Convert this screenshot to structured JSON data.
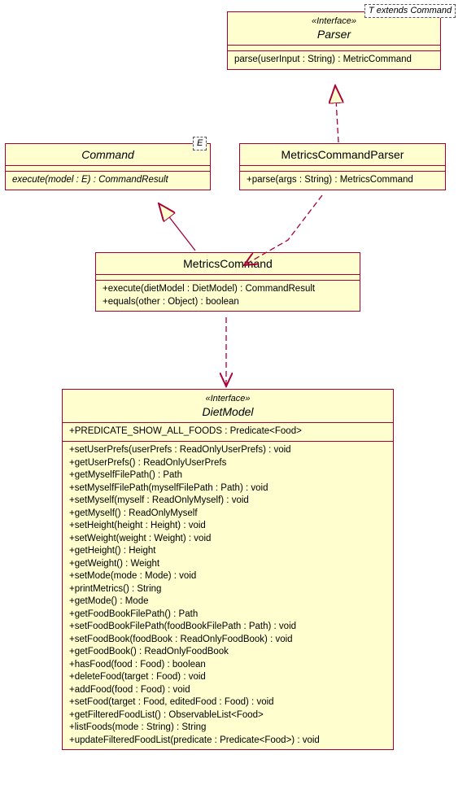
{
  "parser": {
    "stereotype": "«Interface»",
    "name": "Parser",
    "param": "T extends Command",
    "ops": [
      "parse(userInput : String) : MetricCommand"
    ]
  },
  "command": {
    "name": "Command",
    "param": "E",
    "ops": [
      "execute(model : E) : CommandResult"
    ]
  },
  "mcp": {
    "name": "MetricsCommandParser",
    "ops": [
      "+parse(args : String) : MetricsCommand"
    ]
  },
  "mc": {
    "name": "MetricsCommand",
    "ops": [
      "+execute(dietModel : DietModel) : CommandResult",
      "+equals(other : Object) : boolean"
    ]
  },
  "dm": {
    "stereotype": "«Interface»",
    "name": "DietModel",
    "attrs": [
      "+PREDICATE_SHOW_ALL_FOODS : Predicate<Food>"
    ],
    "ops": [
      "+setUserPrefs(userPrefs : ReadOnlyUserPrefs) : void",
      "+getUserPrefs() : ReadOnlyUserPrefs",
      "+getMyselfFilePath() : Path",
      "+setMyselfFilePath(myselfFilePath : Path) : void",
      "+setMyself(myself : ReadOnlyMyself) : void",
      "+getMyself() : ReadOnlyMyself",
      "+setHeight(height : Height) : void",
      "+setWeight(weight : Weight) : void",
      "+getHeight() : Height",
      "+getWeight() : Weight",
      "+setMode(mode : Mode) : void",
      "+printMetrics() : String",
      "+getMode() : Mode",
      "+getFoodBookFilePath() : Path",
      "+setFoodBookFilePath(foodBookFilePath : Path) : void",
      "+setFoodBook(foodBook : ReadOnlyFoodBook) : void",
      "+getFoodBook() : ReadOnlyFoodBook",
      "+hasFood(food : Food) : boolean",
      "+deleteFood(target : Food) : void",
      "+addFood(food : Food) : void",
      "+setFood(target : Food, editedFood : Food) : void",
      "+getFilteredFoodList() : ObservableList<Food>",
      "+listFoods(mode : String) : String",
      "+updateFilteredFoodList(predicate : Predicate<Food>) : void"
    ]
  }
}
